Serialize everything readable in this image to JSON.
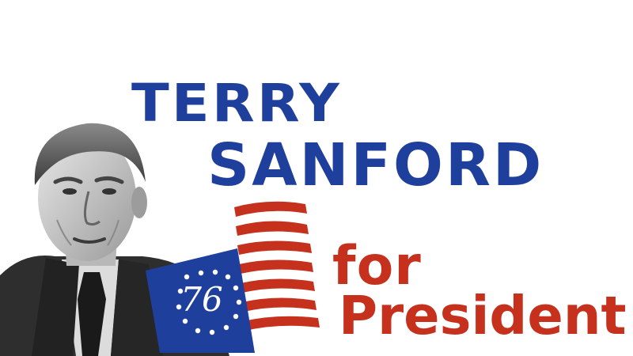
{
  "poster": {
    "name_first": "TERRY",
    "name_last": "SANFORD",
    "tagline_for": "for",
    "tagline_president": "President",
    "badge_year": "76",
    "colors": {
      "blue": "#1f3f9c",
      "red": "#c6311e",
      "background": "#ffffff"
    },
    "photo": "black-and-white portrait of the candidate",
    "flag": "bicentennial flag icon with 13 stars in a circle"
  }
}
